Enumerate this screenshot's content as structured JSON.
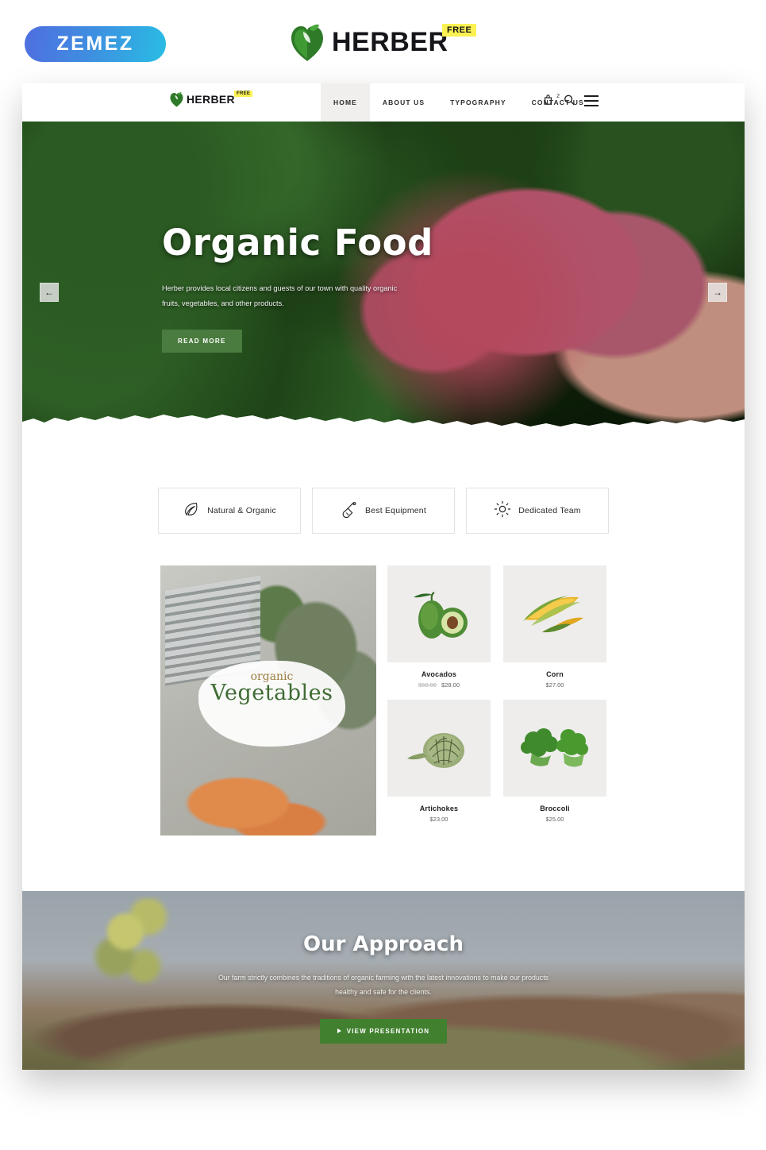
{
  "topbar": {
    "vendor_logo_text": "ZEMEZ",
    "brand_name": "HERBER",
    "badge": "FREE",
    "leaf_icon": "leaf-heart-icon"
  },
  "site": {
    "nav": {
      "logo_text": "HERBER",
      "logo_badge": "FREE",
      "links": [
        {
          "label": "HOME",
          "active": true
        },
        {
          "label": "ABOUT US",
          "active": false
        },
        {
          "label": "TYPOGRAPHY",
          "active": false
        },
        {
          "label": "CONTACT US",
          "active": false
        }
      ],
      "icons": {
        "cart": "cart-icon",
        "cart_count": "2",
        "search": "search-icon",
        "menu": "hamburger-menu-icon"
      }
    },
    "hero": {
      "title": "Organic Food",
      "subtitle": "Herber provides local citizens and guests of our town with quality organic fruits, vegetables, and other products.",
      "cta": "READ MORE",
      "prev_arrow": "←",
      "next_arrow": "→"
    },
    "features": [
      {
        "label": "Natural & Organic",
        "icon": "leaf-icon"
      },
      {
        "label": "Best Equipment",
        "icon": "shovel-icon"
      },
      {
        "label": "Dedicated Team",
        "icon": "sun-icon"
      }
    ],
    "promo": {
      "small_text": "organic",
      "big_text": "Vegetables"
    },
    "products": [
      {
        "name": "Avocados",
        "old_price": "$60.00",
        "price": "$28.00",
        "image": "avocado-image"
      },
      {
        "name": "Corn",
        "old_price": "",
        "price": "$27.00",
        "image": "corn-image"
      },
      {
        "name": "Artichokes",
        "old_price": "",
        "price": "$23.00",
        "image": "artichoke-image"
      },
      {
        "name": "Broccoli",
        "old_price": "",
        "price": "$25.00",
        "image": "broccoli-image"
      }
    ],
    "approach": {
      "title": "Our Approach",
      "text": "Our farm strictly combines the traditions of organic farming with the latest innovations to make our products healthy and safe for the clients.",
      "cta": "VIEW PRESENTATION"
    }
  },
  "colors": {
    "brand_green": "#4a7c3f",
    "button_green": "#41802f",
    "badge_yellow": "#fbf153",
    "nav_active_bg": "#f0efed",
    "product_tile_bg": "#eeedeb"
  }
}
